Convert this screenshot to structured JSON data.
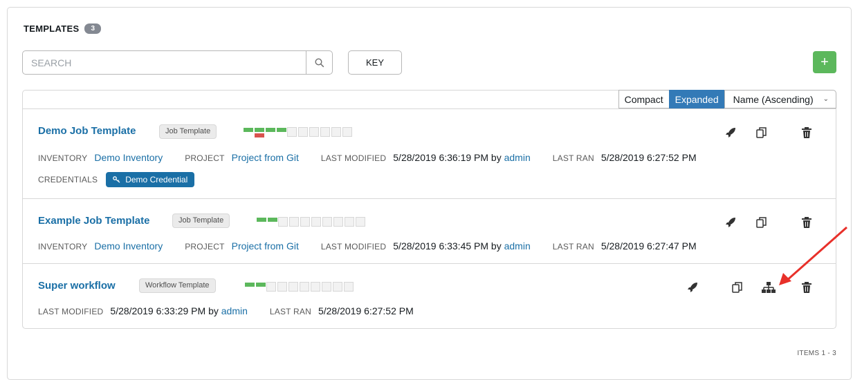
{
  "header": {
    "title": "TEMPLATES",
    "count": "3"
  },
  "search": {
    "placeholder": "SEARCH",
    "value": "",
    "icon": "search-icon"
  },
  "key_button": "KEY",
  "add_button": "+",
  "toolbar": {
    "compact": "Compact",
    "expanded": "Expanded",
    "sort": "Name (Ascending)"
  },
  "templates": [
    {
      "name": "Demo Job Template",
      "type": "Job Template",
      "job_statuses": [
        "success",
        "failed",
        "success",
        "success",
        "none",
        "none",
        "none",
        "none",
        "none",
        "none"
      ],
      "inventory_label": "INVENTORY",
      "inventory": "Demo Inventory",
      "project_label": "PROJECT",
      "project": "Project from Git",
      "last_modified_label": "LAST MODIFIED",
      "last_modified": "5/28/2019 6:36:19 PM by ",
      "modified_by": "admin",
      "last_ran_label": "LAST RAN",
      "last_ran": "5/28/2019 6:27:52 PM",
      "credentials_label": "CREDENTIALS",
      "credential": "Demo Credential"
    },
    {
      "name": "Example Job Template",
      "type": "Job Template",
      "job_statuses": [
        "success",
        "success",
        "none",
        "none",
        "none",
        "none",
        "none",
        "none",
        "none",
        "none"
      ],
      "inventory_label": "INVENTORY",
      "inventory": "Demo Inventory",
      "project_label": "PROJECT",
      "project": "Project from Git",
      "last_modified_label": "LAST MODIFIED",
      "last_modified": "5/28/2019 6:33:45 PM by ",
      "modified_by": "admin",
      "last_ran_label": "LAST RAN",
      "last_ran": "5/28/2019 6:27:47 PM"
    },
    {
      "name": "Super workflow",
      "type": "Workflow Template",
      "job_statuses": [
        "success",
        "success",
        "none",
        "none",
        "none",
        "none",
        "none",
        "none",
        "none",
        "none"
      ],
      "last_modified_label": "LAST MODIFIED",
      "last_modified": "5/28/2019 6:33:29 PM by ",
      "modified_by": "admin",
      "last_ran_label": "LAST RAN",
      "last_ran": "5/28/2019 6:27:52 PM"
    }
  ],
  "pagination": {
    "items": "ITEMS  1 - 3"
  },
  "colors": {
    "link": "#1a6fa6",
    "success": "#5cb85c",
    "failed": "#d9534f",
    "active_toggle": "#337ab7",
    "annotation_arrow": "#e8302a"
  },
  "icons": {
    "launch": "rocket-icon",
    "copy": "copy-icon",
    "visualizer": "sitemap-icon",
    "delete": "trash-icon"
  }
}
